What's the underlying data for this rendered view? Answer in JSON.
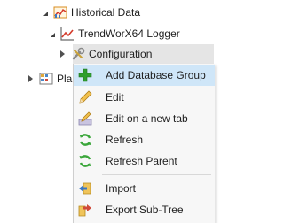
{
  "tree": {
    "items": [
      {
        "label": "Historical Data",
        "icon": "historical-data-icon",
        "expanded": true
      },
      {
        "label": "TrendWorX64 Logger",
        "icon": "chart-icon",
        "expanded": true
      },
      {
        "label": "Configuration",
        "icon": "configuration-icon",
        "expanded": false,
        "selected": true
      },
      {
        "label": "Pla",
        "icon": "grid-icon",
        "expanded": false
      }
    ]
  },
  "context_menu": {
    "items": [
      {
        "label": "Add Database Group",
        "icon": "plus-icon",
        "highlighted": true
      },
      {
        "label": "Edit",
        "icon": "pencil-icon"
      },
      {
        "label": "Edit on a new tab",
        "icon": "edit-tab-icon"
      },
      {
        "label": "Refresh",
        "icon": "refresh-icon"
      },
      {
        "label": "Refresh Parent",
        "icon": "refresh-parent-icon"
      },
      {
        "label": "Import",
        "icon": "import-icon"
      },
      {
        "label": "Export Sub-Tree",
        "icon": "export-icon"
      }
    ]
  },
  "colors": {
    "highlight": "#cfe6f8",
    "selection": "#e5e5e5",
    "menu_background": "#f7f7f7",
    "refresh_green": "#3aa63a",
    "plus_green": "#2e9e2e"
  }
}
